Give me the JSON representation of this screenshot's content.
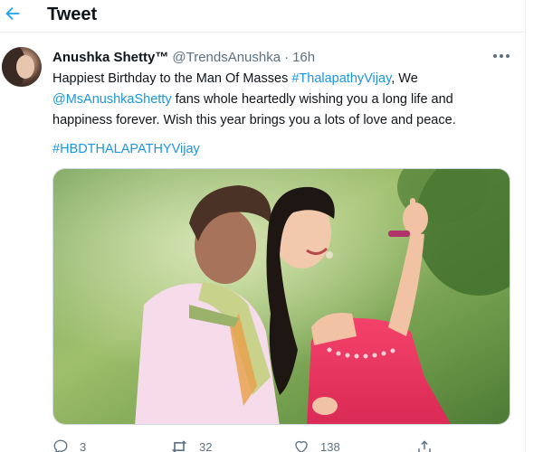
{
  "header": {
    "title": "Tweet"
  },
  "tweet": {
    "display_name": "Anushka Shetty™",
    "handle": "@TrendsAnushka",
    "separator": "·",
    "time": "16h",
    "text": {
      "line1_prefix": "Happiest Birthday to the Man Of Masses ",
      "line1_hashtag": "#ThalapathyVijay",
      "line1_suffix": ", We",
      "line2_mention": "@MsAnushkaShetty",
      "line2_suffix": " fans whole heartedly wishing you a long life and",
      "line3": "happiness forever. Wish this year brings you a lots of love and peace."
    },
    "hashtag": "#HBDTHALAPATHYVijay",
    "actions": {
      "replies": "3",
      "retweets": "32",
      "likes": "138"
    }
  },
  "icons": {
    "back": "arrow-left-icon",
    "more": "more-horizontal-icon",
    "reply": "reply-icon",
    "retweet": "retweet-icon",
    "like": "heart-icon",
    "share": "share-icon"
  },
  "colors": {
    "accent": "#1da1f2",
    "link": "#1b95e0",
    "muted": "#5b7083",
    "text": "#0f1419",
    "border": "#ebeef0"
  }
}
